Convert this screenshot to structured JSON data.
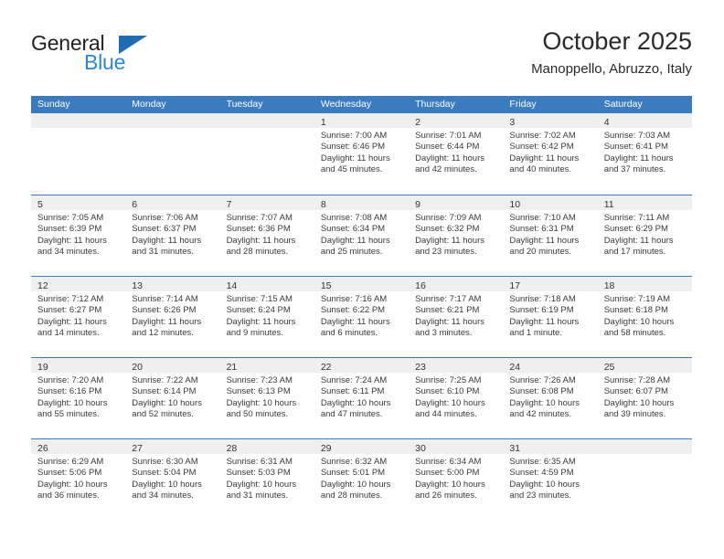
{
  "brand": {
    "name_top": "General",
    "name_bottom": "Blue",
    "color_dark": "#231f20",
    "color_blue": "#2a87d0",
    "triangle_color": "#1f6cb0"
  },
  "header": {
    "title": "October 2025",
    "subtitle": "Manoppello, Abruzzo, Italy"
  },
  "theme": {
    "header_row_bg": "#3b7cbf",
    "daynum_band_bg": "#efefef",
    "divider": "#3b7cbf"
  },
  "weekdays": [
    "Sunday",
    "Monday",
    "Tuesday",
    "Wednesday",
    "Thursday",
    "Friday",
    "Saturday"
  ],
  "weeks": [
    [
      {
        "day": "",
        "sunrise": "",
        "sunset": "",
        "daylight_1": "",
        "daylight_2": ""
      },
      {
        "day": "",
        "sunrise": "",
        "sunset": "",
        "daylight_1": "",
        "daylight_2": ""
      },
      {
        "day": "",
        "sunrise": "",
        "sunset": "",
        "daylight_1": "",
        "daylight_2": ""
      },
      {
        "day": "1",
        "sunrise": "Sunrise: 7:00 AM",
        "sunset": "Sunset: 6:46 PM",
        "daylight_1": "Daylight: 11 hours",
        "daylight_2": "and 45 minutes."
      },
      {
        "day": "2",
        "sunrise": "Sunrise: 7:01 AM",
        "sunset": "Sunset: 6:44 PM",
        "daylight_1": "Daylight: 11 hours",
        "daylight_2": "and 42 minutes."
      },
      {
        "day": "3",
        "sunrise": "Sunrise: 7:02 AM",
        "sunset": "Sunset: 6:42 PM",
        "daylight_1": "Daylight: 11 hours",
        "daylight_2": "and 40 minutes."
      },
      {
        "day": "4",
        "sunrise": "Sunrise: 7:03 AM",
        "sunset": "Sunset: 6:41 PM",
        "daylight_1": "Daylight: 11 hours",
        "daylight_2": "and 37 minutes."
      }
    ],
    [
      {
        "day": "5",
        "sunrise": "Sunrise: 7:05 AM",
        "sunset": "Sunset: 6:39 PM",
        "daylight_1": "Daylight: 11 hours",
        "daylight_2": "and 34 minutes."
      },
      {
        "day": "6",
        "sunrise": "Sunrise: 7:06 AM",
        "sunset": "Sunset: 6:37 PM",
        "daylight_1": "Daylight: 11 hours",
        "daylight_2": "and 31 minutes."
      },
      {
        "day": "7",
        "sunrise": "Sunrise: 7:07 AM",
        "sunset": "Sunset: 6:36 PM",
        "daylight_1": "Daylight: 11 hours",
        "daylight_2": "and 28 minutes."
      },
      {
        "day": "8",
        "sunrise": "Sunrise: 7:08 AM",
        "sunset": "Sunset: 6:34 PM",
        "daylight_1": "Daylight: 11 hours",
        "daylight_2": "and 25 minutes."
      },
      {
        "day": "9",
        "sunrise": "Sunrise: 7:09 AM",
        "sunset": "Sunset: 6:32 PM",
        "daylight_1": "Daylight: 11 hours",
        "daylight_2": "and 23 minutes."
      },
      {
        "day": "10",
        "sunrise": "Sunrise: 7:10 AM",
        "sunset": "Sunset: 6:31 PM",
        "daylight_1": "Daylight: 11 hours",
        "daylight_2": "and 20 minutes."
      },
      {
        "day": "11",
        "sunrise": "Sunrise: 7:11 AM",
        "sunset": "Sunset: 6:29 PM",
        "daylight_1": "Daylight: 11 hours",
        "daylight_2": "and 17 minutes."
      }
    ],
    [
      {
        "day": "12",
        "sunrise": "Sunrise: 7:12 AM",
        "sunset": "Sunset: 6:27 PM",
        "daylight_1": "Daylight: 11 hours",
        "daylight_2": "and 14 minutes."
      },
      {
        "day": "13",
        "sunrise": "Sunrise: 7:14 AM",
        "sunset": "Sunset: 6:26 PM",
        "daylight_1": "Daylight: 11 hours",
        "daylight_2": "and 12 minutes."
      },
      {
        "day": "14",
        "sunrise": "Sunrise: 7:15 AM",
        "sunset": "Sunset: 6:24 PM",
        "daylight_1": "Daylight: 11 hours",
        "daylight_2": "and 9 minutes."
      },
      {
        "day": "15",
        "sunrise": "Sunrise: 7:16 AM",
        "sunset": "Sunset: 6:22 PM",
        "daylight_1": "Daylight: 11 hours",
        "daylight_2": "and 6 minutes."
      },
      {
        "day": "16",
        "sunrise": "Sunrise: 7:17 AM",
        "sunset": "Sunset: 6:21 PM",
        "daylight_1": "Daylight: 11 hours",
        "daylight_2": "and 3 minutes."
      },
      {
        "day": "17",
        "sunrise": "Sunrise: 7:18 AM",
        "sunset": "Sunset: 6:19 PM",
        "daylight_1": "Daylight: 11 hours",
        "daylight_2": "and 1 minute."
      },
      {
        "day": "18",
        "sunrise": "Sunrise: 7:19 AM",
        "sunset": "Sunset: 6:18 PM",
        "daylight_1": "Daylight: 10 hours",
        "daylight_2": "and 58 minutes."
      }
    ],
    [
      {
        "day": "19",
        "sunrise": "Sunrise: 7:20 AM",
        "sunset": "Sunset: 6:16 PM",
        "daylight_1": "Daylight: 10 hours",
        "daylight_2": "and 55 minutes."
      },
      {
        "day": "20",
        "sunrise": "Sunrise: 7:22 AM",
        "sunset": "Sunset: 6:14 PM",
        "daylight_1": "Daylight: 10 hours",
        "daylight_2": "and 52 minutes."
      },
      {
        "day": "21",
        "sunrise": "Sunrise: 7:23 AM",
        "sunset": "Sunset: 6:13 PM",
        "daylight_1": "Daylight: 10 hours",
        "daylight_2": "and 50 minutes."
      },
      {
        "day": "22",
        "sunrise": "Sunrise: 7:24 AM",
        "sunset": "Sunset: 6:11 PM",
        "daylight_1": "Daylight: 10 hours",
        "daylight_2": "and 47 minutes."
      },
      {
        "day": "23",
        "sunrise": "Sunrise: 7:25 AM",
        "sunset": "Sunset: 6:10 PM",
        "daylight_1": "Daylight: 10 hours",
        "daylight_2": "and 44 minutes."
      },
      {
        "day": "24",
        "sunrise": "Sunrise: 7:26 AM",
        "sunset": "Sunset: 6:08 PM",
        "daylight_1": "Daylight: 10 hours",
        "daylight_2": "and 42 minutes."
      },
      {
        "day": "25",
        "sunrise": "Sunrise: 7:28 AM",
        "sunset": "Sunset: 6:07 PM",
        "daylight_1": "Daylight: 10 hours",
        "daylight_2": "and 39 minutes."
      }
    ],
    [
      {
        "day": "26",
        "sunrise": "Sunrise: 6:29 AM",
        "sunset": "Sunset: 5:06 PM",
        "daylight_1": "Daylight: 10 hours",
        "daylight_2": "and 36 minutes."
      },
      {
        "day": "27",
        "sunrise": "Sunrise: 6:30 AM",
        "sunset": "Sunset: 5:04 PM",
        "daylight_1": "Daylight: 10 hours",
        "daylight_2": "and 34 minutes."
      },
      {
        "day": "28",
        "sunrise": "Sunrise: 6:31 AM",
        "sunset": "Sunset: 5:03 PM",
        "daylight_1": "Daylight: 10 hours",
        "daylight_2": "and 31 minutes."
      },
      {
        "day": "29",
        "sunrise": "Sunrise: 6:32 AM",
        "sunset": "Sunset: 5:01 PM",
        "daylight_1": "Daylight: 10 hours",
        "daylight_2": "and 28 minutes."
      },
      {
        "day": "30",
        "sunrise": "Sunrise: 6:34 AM",
        "sunset": "Sunset: 5:00 PM",
        "daylight_1": "Daylight: 10 hours",
        "daylight_2": "and 26 minutes."
      },
      {
        "day": "31",
        "sunrise": "Sunrise: 6:35 AM",
        "sunset": "Sunset: 4:59 PM",
        "daylight_1": "Daylight: 10 hours",
        "daylight_2": "and 23 minutes."
      },
      {
        "day": "",
        "sunrise": "",
        "sunset": "",
        "daylight_1": "",
        "daylight_2": ""
      }
    ]
  ]
}
